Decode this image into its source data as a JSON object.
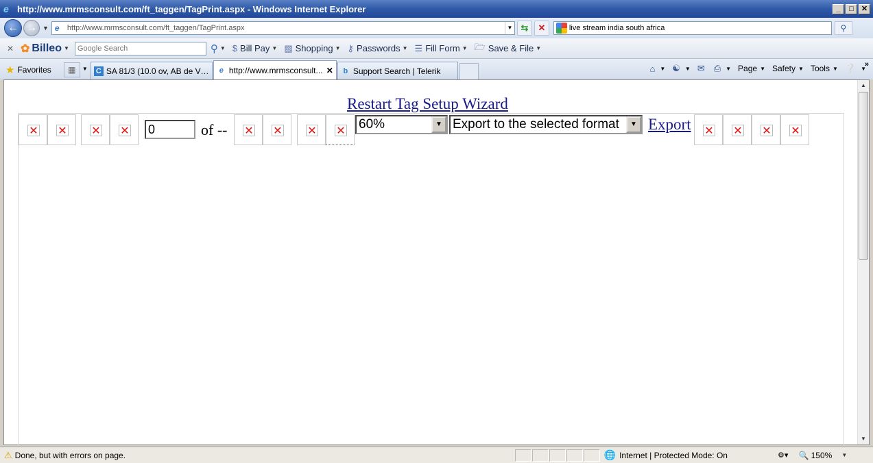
{
  "window": {
    "title": "http://www.mrmsconsult.com/ft_taggen/TagPrint.aspx - Windows Internet Explorer",
    "minimize": "_",
    "maximize": "□",
    "close": "✕"
  },
  "address": {
    "url": "http://www.mrmsconsult.com/ft_taggen/TagPrint.aspx",
    "search_text": "live stream india south africa"
  },
  "billeo": {
    "brand": "Billeo",
    "search_placeholder": "Google Search",
    "items": [
      "Bill Pay",
      "Shopping",
      "Passwords",
      "Fill Form",
      "Save & File"
    ]
  },
  "tabs": {
    "favorites": "Favorites",
    "items": [
      {
        "label": "SA 81/3 (10.0 ov, AB de Villi...",
        "icon": "C"
      },
      {
        "label": "http://www.mrmsconsult...",
        "icon": "e"
      },
      {
        "label": "Support Search | Telerik",
        "icon": "b"
      }
    ],
    "commands": [
      "Page",
      "Safety",
      "Tools"
    ]
  },
  "report": {
    "restart_link": "Restart Tag Setup Wizard",
    "page_value": "0",
    "of_text": "of --",
    "zoom_value": "60%",
    "export_format": "Export to the selected format",
    "export_link": "Export"
  },
  "status": {
    "message": "Done, but with errors on page.",
    "zone": "Internet | Protected Mode: On",
    "zoom": "150%"
  }
}
